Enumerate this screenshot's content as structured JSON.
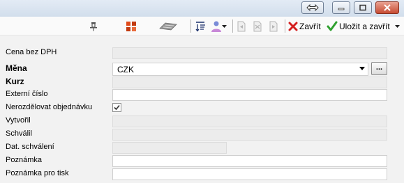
{
  "toolbar": {
    "close_label": "Zavřít",
    "save_close_label": "Uložit a zavřít"
  },
  "form": {
    "price_label": "Cena bez DPH",
    "price_value": "",
    "currency_label": "Měna",
    "currency_value": "CZK",
    "currency_button": "...",
    "rate_label": "Kurz",
    "rate_value": "",
    "external_label": "Externí číslo",
    "external_value": "",
    "nosplit_label": "Nerozdělovat objednávku",
    "nosplit_checked": true,
    "created_label": "Vytvořil",
    "created_value": "",
    "approved_label": "Schválil",
    "approved_value": "",
    "approval_date_label": "Dat. schválení",
    "approval_date_value": "",
    "note_label": "Poznámka",
    "note_value": "",
    "print_note_label": "Poznámka pro tisk",
    "print_note_value": ""
  },
  "colors": {
    "close_x": "#d42020",
    "save_check": "#2fa02f",
    "grid_orange": "#e04a1a"
  }
}
